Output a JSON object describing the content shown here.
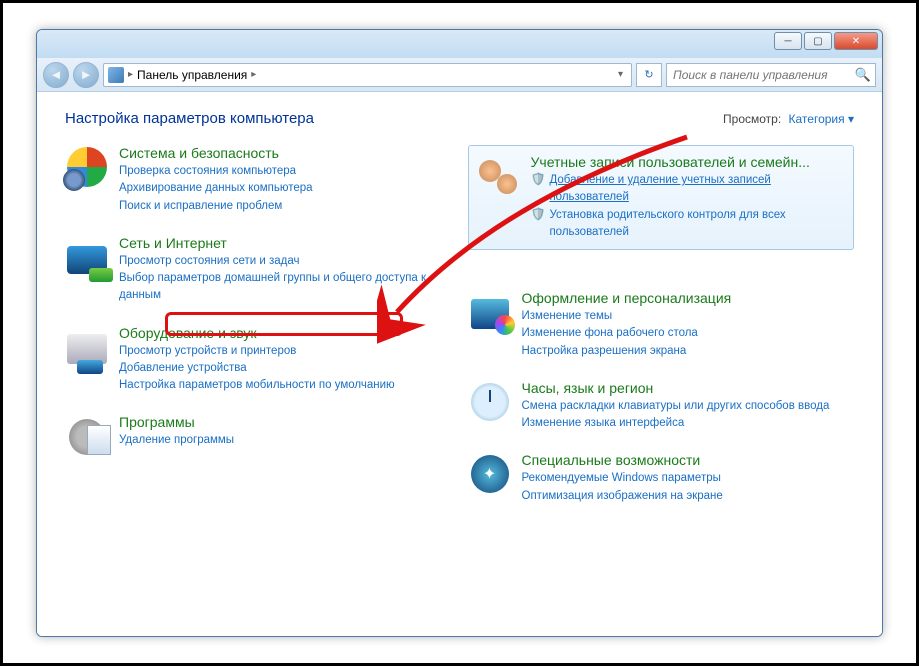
{
  "breadcrumb": {
    "root": "Панель управления"
  },
  "search": {
    "placeholder": "Поиск в панели управления"
  },
  "page_title": "Настройка параметров компьютера",
  "view": {
    "label": "Просмотр:",
    "mode": "Категория"
  },
  "left": [
    {
      "title": "Система и безопасность",
      "links": [
        "Проверка состояния компьютера",
        "Архивирование данных компьютера",
        "Поиск и исправление проблем"
      ]
    },
    {
      "title": "Сеть и Интернет",
      "links": [
        "Просмотр состояния сети и задач",
        "Выбор параметров домашней группы и общего доступа к данным"
      ]
    },
    {
      "title": "Оборудование и звук",
      "links": [
        "Просмотр устройств и принтеров",
        "Добавление устройства",
        "Настройка параметров мобильности по умолчанию"
      ]
    },
    {
      "title": "Программы",
      "links": [
        "Удаление программы"
      ]
    }
  ],
  "right": [
    {
      "title": "Учетные записи пользователей и семейн...",
      "shield_links": [
        "Добавление и удаление учетных записей пользователей",
        "Установка родительского контроля для всех пользователей"
      ],
      "highlighted": true
    },
    {
      "title": "Оформление и персонализация",
      "links": [
        "Изменение темы",
        "Изменение фона рабочего стола",
        "Настройка разрешения экрана"
      ]
    },
    {
      "title": "Часы, язык и регион",
      "links": [
        "Смена раскладки клавиатуры или других способов ввода",
        "Изменение языка интерфейса"
      ]
    },
    {
      "title": "Специальные возможности",
      "links": [
        "Рекомендуемые Windows параметры",
        "Оптимизация изображения на экране"
      ]
    }
  ]
}
